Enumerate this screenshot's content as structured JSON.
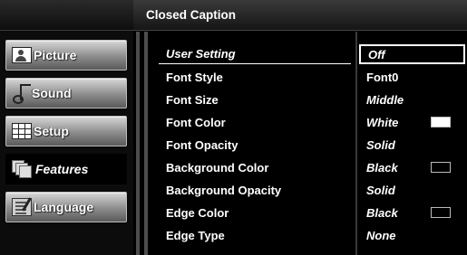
{
  "nav": {
    "items": [
      {
        "label": "Picture",
        "icon": "picture-icon"
      },
      {
        "label": "Sound",
        "icon": "sound-icon"
      },
      {
        "label": "Setup",
        "icon": "setup-icon"
      },
      {
        "label": "Features",
        "icon": "features-icon",
        "active": true
      },
      {
        "label": "Language",
        "icon": "language-icon"
      }
    ]
  },
  "header": {
    "title": "Closed Caption"
  },
  "settings": [
    {
      "label": "User Setting",
      "value": "Off",
      "selected": true
    },
    {
      "label": "Font Style",
      "value": "Font0"
    },
    {
      "label": "Font Size",
      "value": "Middle"
    },
    {
      "label": "Font Color",
      "value": "White",
      "swatch": "#ffffff"
    },
    {
      "label": "Font Opacity",
      "value": "Solid"
    },
    {
      "label": "Background Color",
      "value": "Black",
      "swatch": "#000000"
    },
    {
      "label": "Background Opacity",
      "value": "Solid"
    },
    {
      "label": "Edge Color",
      "value": "Black",
      "swatch": "#000000"
    },
    {
      "label": "Edge Type",
      "value": "None"
    }
  ]
}
